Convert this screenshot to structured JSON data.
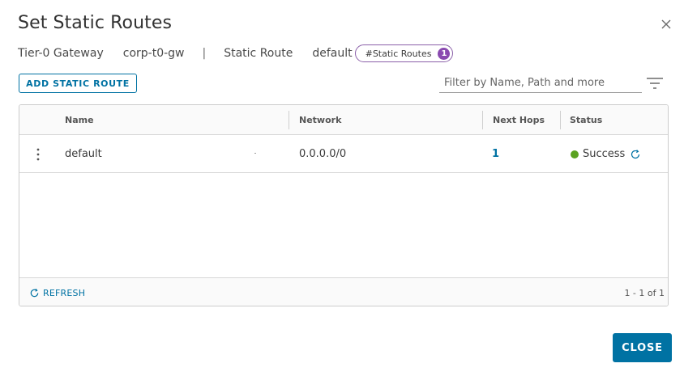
{
  "modal": {
    "title": "Set Static Routes"
  },
  "context": {
    "gateway_type": "Tier-0 Gateway",
    "gateway_name": "corp-t0-gw",
    "separator": "|",
    "object_type": "Static Route",
    "object_name": "default",
    "pill_label": "#Static Routes",
    "pill_count": "1"
  },
  "toolbar": {
    "add_label": "ADD STATIC ROUTE",
    "filter_placeholder": "Filter by Name, Path and more"
  },
  "grid": {
    "columns": [
      "Name",
      "Network",
      "Next Hops",
      "Status"
    ],
    "rows": [
      {
        "name": "default",
        "network": "0.0.0.0/0",
        "next_hops": "1",
        "status": "Success"
      }
    ],
    "footer": {
      "refresh_label": "REFRESH",
      "pagination": "1 - 1 of 1"
    }
  },
  "footer": {
    "close_label": "CLOSE"
  },
  "colors": {
    "primary": "#0072a3",
    "success": "#5aa220",
    "badge": "#8a4ab0"
  },
  "icons": [
    "close-icon",
    "filter-icon",
    "kebab-menu-icon",
    "refresh-icon",
    "status-dot-icon"
  ]
}
